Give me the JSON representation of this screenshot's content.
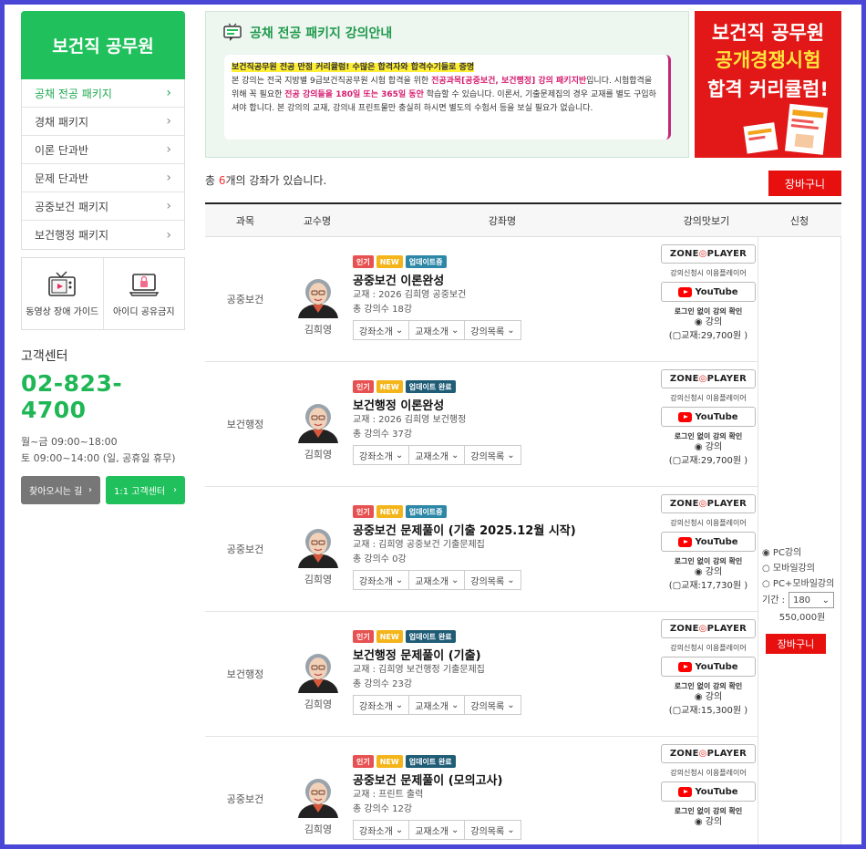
{
  "sidebar": {
    "title": "보건직 공무원",
    "items": [
      {
        "label": "공채 전공 패키지",
        "active": true
      },
      {
        "label": "경채 패키지"
      },
      {
        "label": "이론 단과반"
      },
      {
        "label": "문제 단과반"
      },
      {
        "label": "공중보건 패키지"
      },
      {
        "label": "보건행정 패키지"
      }
    ],
    "guides": [
      {
        "label": "동영상 장애 가이드",
        "icon": "video-tv-icon"
      },
      {
        "label": "아이디 공유금지",
        "icon": "laptop-lock-icon"
      }
    ]
  },
  "customer_center": {
    "label": "고객센터",
    "phone": "02-823-4700",
    "hours_weekday": "월~금 09:00~18:00",
    "hours_sat": "토 09:00~14:00 (일, 공휴일 휴무)",
    "btn_directions": "찾아오시는 길",
    "btn_support": "1:1 고객센터"
  },
  "intro": {
    "title": "공채 전공 패키지 강의안내",
    "highlight": "보건직공무원 전공 만점 커리큘럼! 수많은 합격자와 합격수기들로 증명",
    "p1a": "본 강의는 전국 지방별 9급보건직공무원 시험 합격을 위한 ",
    "p1b": "전공과목[공중보건, 보건행정] 강의 패키지반",
    "p1c": "입니다. 시험합격을 위해 꼭 필요한 ",
    "p1d": "전공 강의들을 180일 또는 365일 동안",
    "p1e": " 학습할 수 있습니다. 이론서, 기출문제집의 경우 교재를 별도 구입하셔야 합니다. 본 강의의 교재, 강의내 프린트물만 충실히 하시면 별도의 수험서 등을 보실 필요가 없습니다."
  },
  "banner": {
    "line1": "보건직 공무원",
    "line2": "공개경쟁시험",
    "line3": "합격 커리큘럼!"
  },
  "list": {
    "count_prefix": "총 ",
    "count": "6",
    "count_suffix": "개의 강좌가 있습니다.",
    "cart_label": "장바구니"
  },
  "table_headers": {
    "subject": "과목",
    "professor": "교수명",
    "course": "강좌명",
    "preview": "강의맛보기",
    "apply": "신청"
  },
  "course_buttons": [
    "강좌소개",
    "교재소개",
    "강의목록"
  ],
  "player": {
    "zone_a": "ZONE",
    "zone_b": "PLAYER",
    "player_note": "강의신청시 이용플레이어",
    "youtube": "YouTube",
    "login_note": "로그인 없이 강의 확인",
    "lecture": "강의"
  },
  "courses": [
    {
      "subject": "공중보건",
      "professor": "김희영",
      "tags": [
        {
          "text": "인기",
          "cls": "t-pop"
        },
        {
          "text": "NEW",
          "cls": "t-new"
        },
        {
          "text": "업데이트중",
          "cls": "t-up"
        }
      ],
      "name": "공중보건 이론완성",
      "book": "교재 : 2026 김희영 공중보건",
      "lectures": "총 강의수 18강",
      "book_price": "(▢교재:29,700원 )"
    },
    {
      "subject": "보건행정",
      "professor": "김희영",
      "tags": [
        {
          "text": "인기",
          "cls": "t-pop"
        },
        {
          "text": "NEW",
          "cls": "t-new"
        },
        {
          "text": "업데이트 완료",
          "cls": "t-done"
        }
      ],
      "name": "보건행정 이론완성",
      "book": "교재 : 2026 김희영 보건행정",
      "lectures": "총 강의수 37강",
      "book_price": "(▢교재:29,700원 )"
    },
    {
      "subject": "공중보건",
      "professor": "김희영",
      "tags": [
        {
          "text": "인기",
          "cls": "t-pop"
        },
        {
          "text": "NEW",
          "cls": "t-new"
        },
        {
          "text": "업데이트중",
          "cls": "t-up"
        }
      ],
      "name": "공중보건 문제풀이 (기출 2025.12월 시작)",
      "book": "교재 : 김희영 공중보건 기출문제집",
      "lectures": "총 강의수 0강",
      "book_price": "(▢교재:17,730원 )"
    },
    {
      "subject": "보건행정",
      "professor": "김희영",
      "tags": [
        {
          "text": "인기",
          "cls": "t-pop"
        },
        {
          "text": "NEW",
          "cls": "t-new"
        },
        {
          "text": "업데이트 완료",
          "cls": "t-done"
        }
      ],
      "name": "보건행정 문제풀이 (기출)",
      "book": "교재 : 김희영 보건행정 기출문제집",
      "lectures": "총 강의수 23강",
      "book_price": "(▢교재:15,300원 )"
    },
    {
      "subject": "공중보건",
      "professor": "김희영",
      "tags": [
        {
          "text": "인기",
          "cls": "t-pop"
        },
        {
          "text": "NEW",
          "cls": "t-new"
        },
        {
          "text": "업데이트 완료",
          "cls": "t-done"
        }
      ],
      "name": "공중보건 문제풀이 (모의고사)",
      "book": "교재 : 프린트 출력",
      "lectures": "총 강의수 12강",
      "book_price": ""
    }
  ],
  "apply": {
    "opt_pc": "PC강의",
    "opt_mobile": "모바일강의",
    "opt_both": "PC+모바일강의",
    "period_label": "기간 :",
    "period_value": "180",
    "price": "550,000원",
    "cart": "장바구니"
  },
  "colors": {
    "brand_green": "#20c05c",
    "cart_red": "#e8100f",
    "frame_blue": "#4a47d6"
  }
}
